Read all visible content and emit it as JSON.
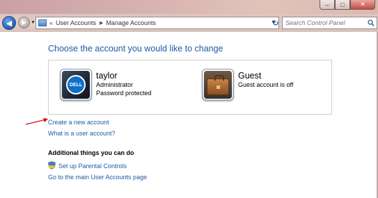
{
  "window": {
    "minimize_glyph": "–",
    "maximize_glyph": "□",
    "close_glyph": "✕"
  },
  "navbar": {
    "back_glyph": "◀",
    "forward_glyph": "▶",
    "breadcrumb_prefix": "«",
    "breadcrumbs": [
      {
        "label": "User Accounts"
      },
      {
        "label": "Manage Accounts"
      }
    ],
    "breadcrumb_arrow": "▶",
    "dropdown_glyph": "▼",
    "refresh_glyph": "↻",
    "search_placeholder": "Search Control Panel"
  },
  "main": {
    "title": "Choose the account you would like to change",
    "accounts": [
      {
        "name": "taylor",
        "lines": [
          "Administrator",
          "Password protected"
        ],
        "avatar_icon": "dell-logo-icon",
        "logo_text": "DELL"
      },
      {
        "name": "Guest",
        "lines": [
          "Guest account is off"
        ],
        "avatar_icon": "briefcase-icon"
      }
    ],
    "links": {
      "create": "Create a new account",
      "what_is": "What is a user account?"
    },
    "additional": {
      "heading": "Additional things you can do",
      "parental": "Set up Parental Controls",
      "main_page": "Go to the main User Accounts page"
    }
  },
  "colors": {
    "link": "#1e5aa8",
    "title": "#1e5aa8",
    "annotation_arrow": "#d01010"
  }
}
